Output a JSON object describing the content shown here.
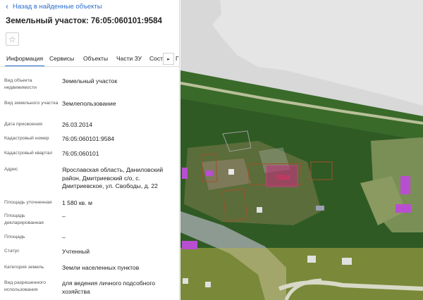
{
  "panel": {
    "back_label": "Назад в найденные объекты",
    "title": "Земельный участок: 76:05:060101:9584",
    "tabs": [
      {
        "label": "Информация"
      },
      {
        "label": "Сервисы"
      },
      {
        "label": "Объекты"
      },
      {
        "label": "Части ЗУ"
      },
      {
        "label": "Соста"
      }
    ],
    "tab_tail": "Г",
    "rows": [
      {
        "key": "Вид объекта недвижимости",
        "value": "Земельный участок"
      },
      {
        "key": "Вид земельного участка",
        "value": "Землепользование"
      },
      {
        "key": "Дата присвоения",
        "value": "26.03.2014"
      },
      {
        "key": "Кадастровый номер",
        "value": "76:05:060101:9584"
      },
      {
        "key": "Кадастровый квартал",
        "value": "76:05:060101"
      },
      {
        "key": "Адрес",
        "value": "Ярославская область, Даниловский район, Дмитриевский с/о, с. Дмитриевское, ул. Свободы, д. 22"
      },
      {
        "key": "Площадь уточненная",
        "value": "1 580 кв. м"
      },
      {
        "key": "Площадь декларированная",
        "value": "–"
      },
      {
        "key": "Площадь",
        "value": "–"
      },
      {
        "key": "Статус",
        "value": "Учтенный"
      },
      {
        "key": "Категория земель",
        "value": "Земли населенных пунктов"
      },
      {
        "key": "Вид разрешенного использования",
        "value": "для ведения личного подсобного хозяйства"
      }
    ]
  },
  "map": {
    "parcel_label": "9584",
    "colors": {
      "forest": "#2f5a24",
      "highlight": "#c0307a",
      "link": "#2c6fd1"
    }
  }
}
